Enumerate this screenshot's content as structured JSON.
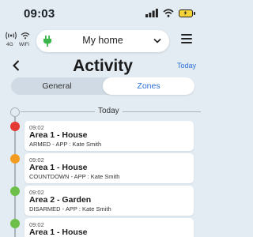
{
  "status_bar": {
    "time": "09:03"
  },
  "connectivity": {
    "signal_label": "4G",
    "wifi_label": "WiFi"
  },
  "home_selector": {
    "name": "My home"
  },
  "header": {
    "title": "Activity",
    "today_link": "Today"
  },
  "tabs": [
    {
      "label": "General",
      "selected": false
    },
    {
      "label": "Zones",
      "selected": true
    }
  ],
  "timeline": {
    "day_label": "Today",
    "events": [
      {
        "time": "09:02",
        "name": "Area 1 - House",
        "detail": "ARMED - APP : Kate Smith",
        "status_color": "#e53935"
      },
      {
        "time": "09:02",
        "name": "Area 1 - House",
        "detail": "COUNTDOWN - APP : Kate Smith",
        "status_color": "#f39c1f"
      },
      {
        "time": "09:02",
        "name": "Area 2 - Garden",
        "detail": "DISARMED - APP : Kate Smith",
        "status_color": "#6cc04a"
      },
      {
        "time": "09:02",
        "name": "Area 1 - House",
        "detail": "",
        "status_color": "#6cc04a"
      }
    ]
  },
  "colors": {
    "accent": "#2b6fd6",
    "background": "#e3ecf3",
    "plug_green": "#3bb54a"
  }
}
